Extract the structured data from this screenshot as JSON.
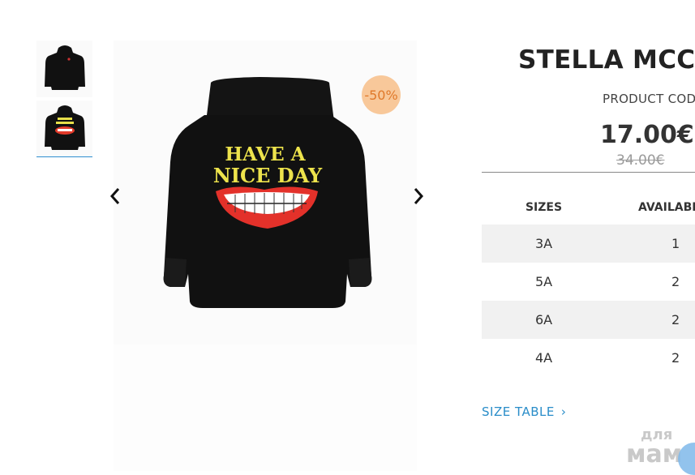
{
  "product": {
    "title": "STELLA MCCA",
    "code_label": "PRODUCT COD",
    "price": "17.00€",
    "old_price": "34.00€",
    "discount_badge": "-50%",
    "print_text_line1": "HAVE A",
    "print_text_line2": "NICE DAY"
  },
  "gallery": {
    "thumbnails": [
      "hoodie-front-thumb",
      "hoodie-back-thumb"
    ],
    "active_thumbnail": 1,
    "prev_icon": "chevron-left-icon",
    "next_icon": "chevron-right-icon"
  },
  "sizes": {
    "header_size": "SIZES",
    "header_availability": "AVAILABIL",
    "rows": [
      {
        "size": "3A",
        "available": "1"
      },
      {
        "size": "5A",
        "available": "2"
      },
      {
        "size": "6A",
        "available": "2"
      },
      {
        "size": "4A",
        "available": "2"
      }
    ]
  },
  "size_table_link": "SIZE TABLE",
  "watermark": {
    "line1": "для",
    "line2": "мам"
  },
  "colors": {
    "accent": "#2a8dc9",
    "badge_bg": "#f8c89a",
    "badge_text": "#e0792a",
    "row_shade": "#f1f1f1"
  }
}
